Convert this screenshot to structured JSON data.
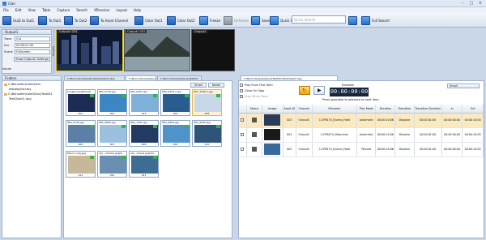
{
  "app": {
    "title": "Clair"
  },
  "menu": [
    "File",
    "Edit",
    "View",
    "Table",
    "Capture",
    "Search",
    "XPression",
    "Layout",
    "Help"
  ],
  "toolbar": {
    "cue_to_out1": "Out2 to Out1",
    "to_out1": "To Out1",
    "to_out2": "To Out2",
    "to_asset_channel": "To Asset Channel",
    "clear_out1": "Clear Out1",
    "clear_out2": "Clear Out2",
    "freeze": "Freeze",
    "unfreeze": "Unfreeze",
    "save": "Save",
    "quick_save": "Quick Save",
    "search_placeholder": "Quick Search",
    "full_search": "Full Search"
  },
  "output_panel": {
    "header": "Output1",
    "trans_label": "Trans",
    "trans_value": "Cut",
    "dur_label": "Dur",
    "dur_value": "00:00:01:00",
    "scene_label": "Scene",
    "scene_value": "Fullscreen",
    "settings_button": "Show Output2 Settings",
    "inputs_label": "Inputs",
    "side_tab": "Settings"
  },
  "monitors": [
    {
      "label": "Output1 003"
    },
    {
      "label": "Output1 001"
    },
    {
      "label": "Output1"
    }
  ],
  "folders": {
    "header": "Folders",
    "items": [
      {
        "name": "C:\\Benorder\\Lake\\Zeus",
        "level": 0
      },
      {
        "name": "testplaylist.lasy",
        "level": 1
      },
      {
        "name": "C:\\Benorder\\Lake\\Zeus\\Test001",
        "level": 0
      },
      {
        "name": "TestClips01.lasy",
        "level": 1
      }
    ]
  },
  "browser": {
    "tabs": [
      "C:\\Benorder\\Lake\\Zeus\\testplaylist.lasy",
      "C:\\Benorder\\Lake\\Zeus",
      "C:\\Benorder\\Lake\\Zeus\\Test001"
    ],
    "size_label": "Small",
    "sort_label": "Name",
    "thumbs": [
      {
        "name": "hongkongnightview",
        "num": "001"
      },
      {
        "name": "IMG_0278.jpg",
        "num": "002"
      },
      {
        "name": "IMG_0437.jpg",
        "num": "003"
      },
      {
        "name": "IMG_0459-2.jpg",
        "num": "004"
      },
      {
        "name": "IMG_3496-1.jpg",
        "num": "005"
      },
      {
        "name": "IMG_6728.jpg",
        "num": "006"
      },
      {
        "name": "IMG_6809.jpg",
        "num": "007"
      },
      {
        "name": "IMG_7297.jpg",
        "num": "008"
      },
      {
        "name": "IMG_9994.jpg",
        "num": "009"
      },
      {
        "name": "IMG_9995.jpg",
        "num": "010"
      },
      {
        "name": "Msuno copy.jpg",
        "num": "011"
      },
      {
        "name": "obj - mumba graph",
        "num": "012"
      },
      {
        "name": "obj - tunnel graphic",
        "num": "013"
      }
    ]
  },
  "playlist": {
    "tab": "C:\\Benorder\\Lake\\Zeus\\Test001\\TestClips01.lasy",
    "play_from_first": "Play From First Item",
    "clear_on_stop": "Clear On Stop",
    "stop_when_done": "Stop When Done",
    "duration_label": "Duration",
    "duration_value": "00:00:00:00",
    "hint": "Press spacebar to advance to next item.",
    "size_label": "Small",
    "columns": [
      "Status",
      "Image",
      "Asset ID",
      "Channel",
      "Filename",
      "Play Mode",
      "Duration",
      "Transition",
      "Transition Duration",
      "In",
      "Out"
    ],
    "rows": [
      {
        "asset": "003",
        "channel": "Output1",
        "file": "C:CP8474_Ecomo_Heat",
        "mode": "Automatic",
        "dur": "00:00:10:06",
        "trans": "Dissolve",
        "tdur": "00:00:01:00",
        "in": "00:00:00:00",
        "out": "00:00:10:05",
        "selected": true
      },
      {
        "asset": "001",
        "channel": "Output1",
        "file": "C:CP8474_Nikonmon",
        "mode": "Automatic",
        "dur": "00:00:10:06",
        "trans": "Dissolve",
        "tdur": "00:00:01:00",
        "in": "00:00:00:00",
        "out": "00:00:10:05",
        "selected": false
      },
      {
        "asset": "002",
        "channel": "Output1",
        "file": "C:CP8474_Ecomo_Heat",
        "mode": "Paused",
        "dur": "00:00:10:06",
        "trans": "Dissolve",
        "tdur": "00:00:01:00",
        "in": "00:00:00:00",
        "out": "00:00:10:05",
        "selected": false
      }
    ]
  }
}
